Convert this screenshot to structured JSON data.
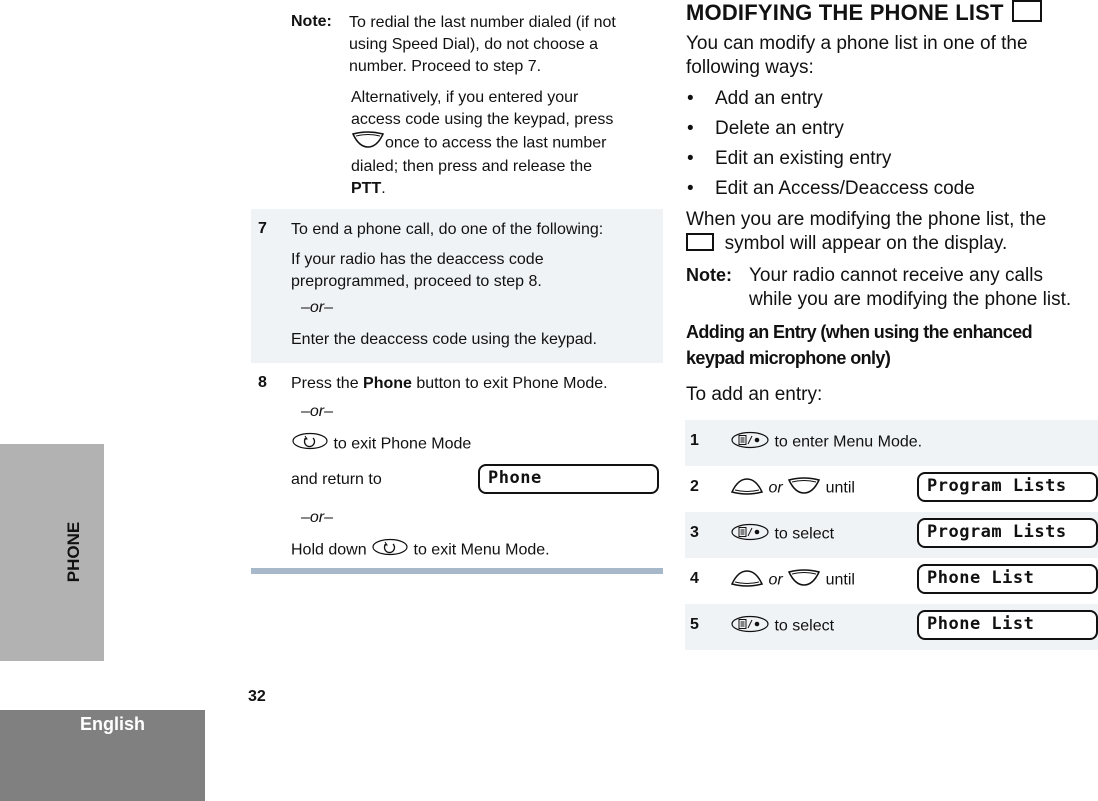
{
  "sidebar": {
    "section_tab": "PHONE",
    "language_tab": "English"
  },
  "page_number": "32",
  "left_column": {
    "note": {
      "label": "Note:",
      "lines": [
        "To redial the last number dialed (if not",
        "using Speed Dial), do not choose a",
        "number. Proceed to step 7."
      ],
      "alt_lines": [
        "Alternatively, if you entered your",
        "access code using the keypad, press",
        "once to access the last number",
        "dialed; then press and release the"
      ],
      "alt_end_bold": "PTT",
      "alt_end_suffix": ".",
      "down_icon": "down-arrow-button-icon"
    },
    "step7": {
      "number": "7",
      "line1": "To end a phone call, do one of the following:",
      "line2a": "If your radio has the deaccess code",
      "line2b": "preprogrammed, proceed to step 8.",
      "or": "–or–",
      "line3": "Enter the deaccess code using the keypad."
    },
    "step8": {
      "number": "8",
      "line1_pre": "Press the ",
      "line1_bold": "Phone",
      "line1_post": " button to exit Phone Mode.",
      "or1": "–or–",
      "line2": "to exit Phone Mode",
      "line3": "and return to",
      "display": "Phone",
      "or2": "–or–",
      "line4_pre": "Hold down",
      "line4_post": "to exit Menu Mode.",
      "exit_icon": "home-exit-button-icon"
    }
  },
  "right_column": {
    "title": "MODIFYING THE PHONE LIST",
    "intro_line1": "You can modify a phone list in one of the",
    "intro_line2": "following ways:",
    "bullets": [
      "Add an entry",
      "Delete an entry",
      "Edit an existing entry",
      "Edit an Access/Deaccess code"
    ],
    "symbol_line1": "When you are modifying the phone list, the",
    "symbol_line2": "symbol will appear on the display.",
    "note_label": "Note:",
    "note_line1": "Your radio cannot receive any calls",
    "note_line2": "while you are modifying the phone list.",
    "subhead_line1": "Adding an Entry (when using the enhanced",
    "subhead_line2": "keypad microphone only)",
    "lead": "To add an entry:",
    "or_word": "or",
    "steps": [
      {
        "number": "1",
        "icon": "menu-select-button-icon",
        "text": "to enter Menu Mode.",
        "display": ""
      },
      {
        "number": "2",
        "icon": "up-down-arrow-buttons-icon",
        "text": "until",
        "display": "Program Lists"
      },
      {
        "number": "3",
        "icon": "menu-select-button-icon",
        "text": "to select",
        "display": "Program Lists"
      },
      {
        "number": "4",
        "icon": "up-down-arrow-buttons-icon",
        "text": "until",
        "display": "Phone List"
      },
      {
        "number": "5",
        "icon": "menu-select-button-icon",
        "text": "to select",
        "display": "Phone List"
      }
    ]
  }
}
